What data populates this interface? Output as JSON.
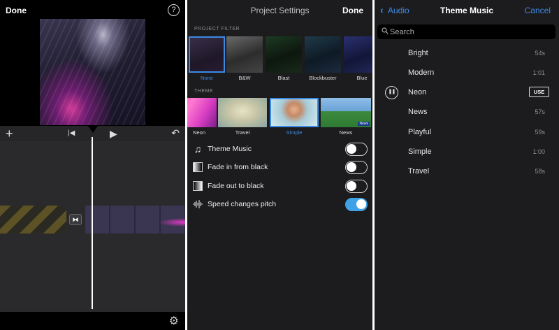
{
  "editor": {
    "done_label": "Done",
    "help_glyph": "?"
  },
  "settings": {
    "title": "Project Settings",
    "done_label": "Done",
    "filter_section_label": "PROJECT FILTER",
    "filters": [
      {
        "label": "None",
        "selected": true
      },
      {
        "label": "B&W",
        "selected": false
      },
      {
        "label": "Blast",
        "selected": false
      },
      {
        "label": "Blockbuster",
        "selected": false
      },
      {
        "label": "Blue",
        "selected": false
      }
    ],
    "theme_section_label": "THEME",
    "themes": [
      {
        "label": "Neon",
        "selected": false
      },
      {
        "label": "Travel",
        "selected": false
      },
      {
        "label": "Simple",
        "selected": true
      },
      {
        "label": "News",
        "selected": false
      }
    ],
    "news_badge": "News",
    "options": [
      {
        "label": "Theme Music",
        "on": false,
        "icon": "music-note-icon"
      },
      {
        "label": "Fade in from black",
        "on": false,
        "icon": "fade-in-icon"
      },
      {
        "label": "Fade out to black",
        "on": false,
        "icon": "fade-out-icon"
      },
      {
        "label": "Speed changes pitch",
        "on": true,
        "icon": "waveform-icon"
      }
    ]
  },
  "music": {
    "back_label": "Audio",
    "title": "Theme Music",
    "cancel_label": "Cancel",
    "search_placeholder": "Search",
    "use_label": "USE",
    "songs": [
      {
        "name": "Bright",
        "duration": "54s",
        "playing": false
      },
      {
        "name": "Modern",
        "duration": "1:01",
        "playing": false
      },
      {
        "name": "Neon",
        "duration": "",
        "playing": true
      },
      {
        "name": "News",
        "duration": "57s",
        "playing": false
      },
      {
        "name": "Playful",
        "duration": "59s",
        "playing": false
      },
      {
        "name": "Simple",
        "duration": "1:00",
        "playing": false
      },
      {
        "name": "Travel",
        "duration": "58s",
        "playing": false
      }
    ]
  },
  "colors": {
    "accent": "#3b8ae6",
    "toggle_on": "#3fa2e6",
    "panel_bg": "#1c1c1e"
  }
}
